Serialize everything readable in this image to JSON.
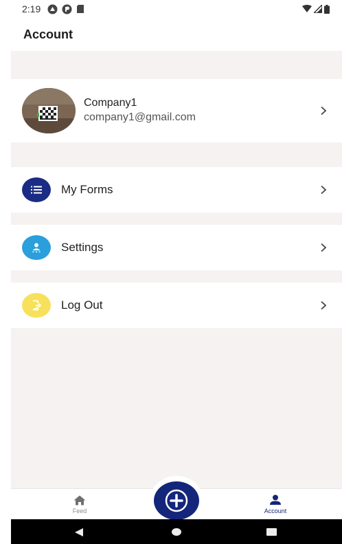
{
  "status_bar": {
    "time": "2:19"
  },
  "header": {
    "title": "Account"
  },
  "profile": {
    "name": "Company1",
    "email": "company1@gmail.com"
  },
  "menu": {
    "my_forms": {
      "label": "My Forms",
      "icon": "list-icon",
      "color": "#1b2c84"
    },
    "settings": {
      "label": "Settings",
      "icon": "person-icon",
      "color": "#2a9fdc"
    },
    "logout": {
      "label": "Log Out",
      "icon": "logout-icon",
      "color": "#f7e15c"
    }
  },
  "bottom_nav": {
    "feed_label": "Feed",
    "account_label": "Account",
    "active": "Account",
    "fab_icon": "plus-icon"
  },
  "colors": {
    "brand": "#14267a",
    "background": "#f7f2f2"
  }
}
